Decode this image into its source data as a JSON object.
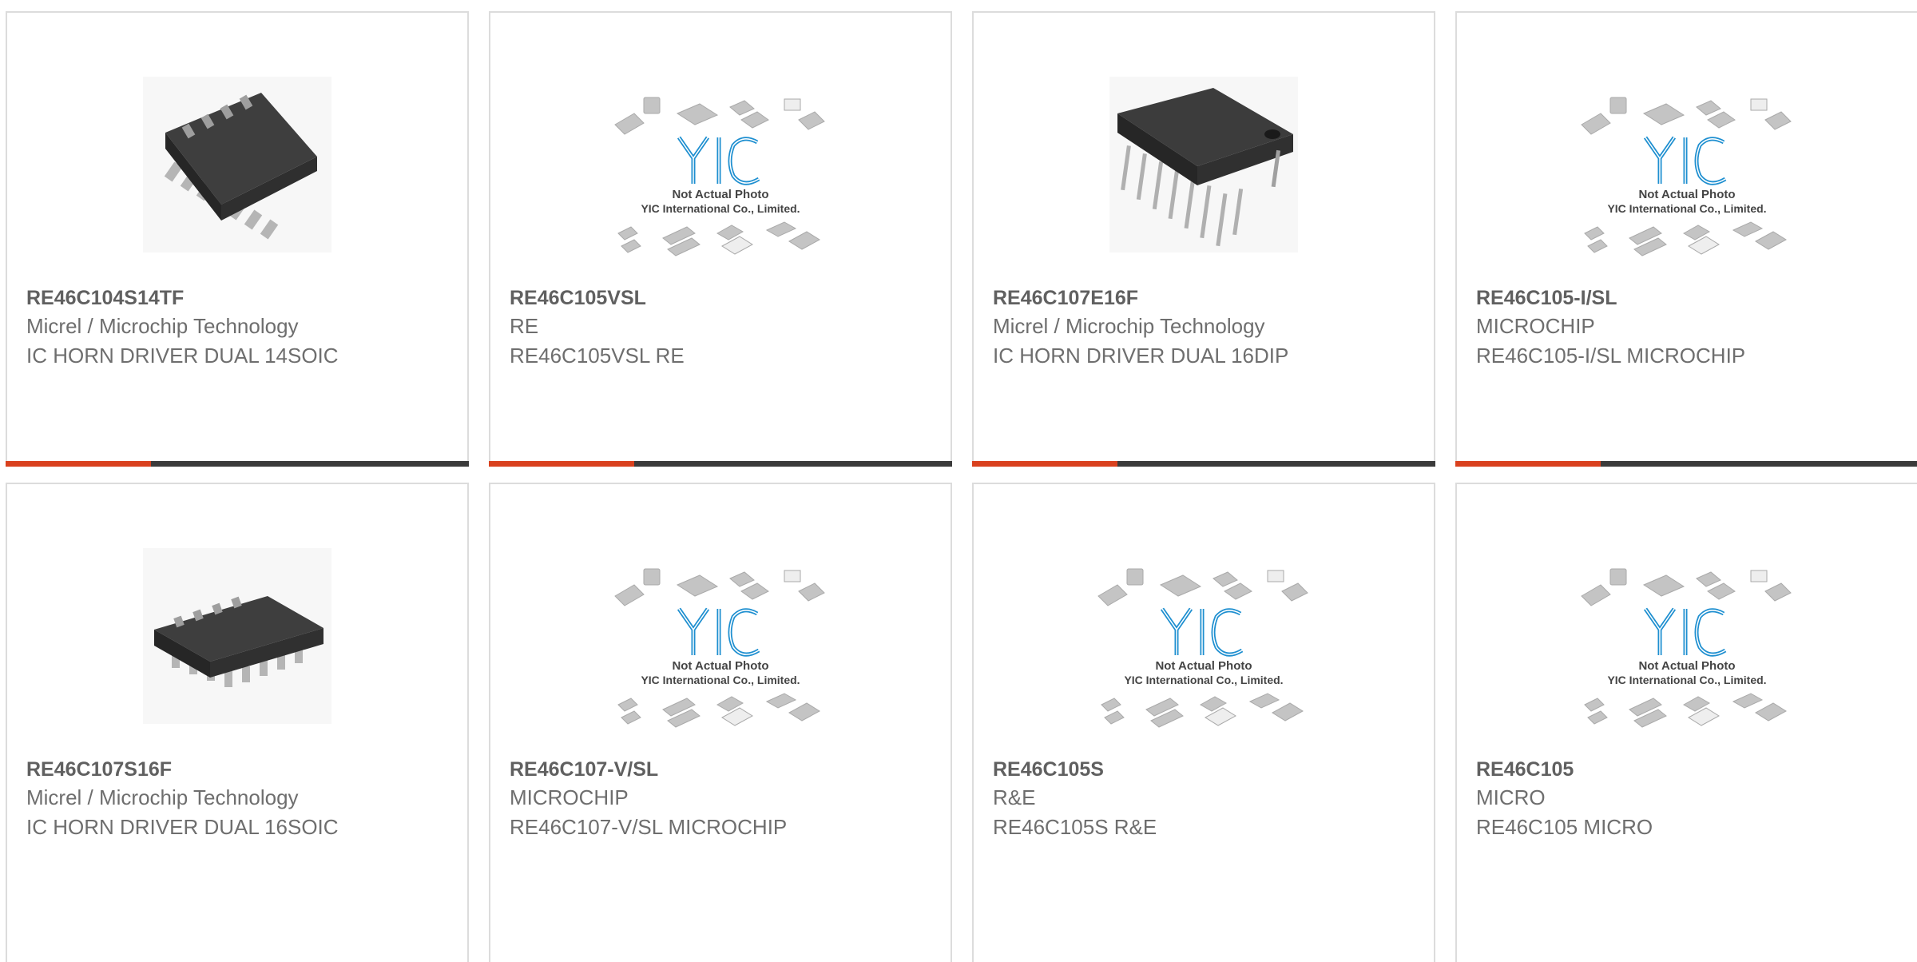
{
  "products": [
    {
      "part_number": "RE46C104S14TF",
      "manufacturer": "Micrel / Microchip Technology",
      "description": "IC HORN DRIVER DUAL 14SOIC",
      "image": "soic-14-chip-photo"
    },
    {
      "part_number": "RE46C105VSL",
      "manufacturer": "RE",
      "description": "RE46C105VSL RE",
      "image": "yic-placeholder"
    },
    {
      "part_number": "RE46C107E16F",
      "manufacturer": "Micrel / Microchip Technology",
      "description": "IC HORN DRIVER DUAL 16DIP",
      "image": "dip-16-chip-photo"
    },
    {
      "part_number": "RE46C105-I/SL",
      "manufacturer": "MICROCHIP",
      "description": "RE46C105-I/SL MICROCHIP",
      "image": "yic-placeholder"
    },
    {
      "part_number": "RE46C107S16F",
      "manufacturer": "Micrel / Microchip Technology",
      "description": "IC HORN DRIVER DUAL 16SOIC",
      "image": "soic-16-chip-photo"
    },
    {
      "part_number": "RE46C107-V/SL",
      "manufacturer": "MICROCHIP",
      "description": "RE46C107-V/SL MICROCHIP",
      "image": "yic-placeholder"
    },
    {
      "part_number": "RE46C105S",
      "manufacturer": "R&E",
      "description": "RE46C105S R&E",
      "image": "yic-placeholder"
    },
    {
      "part_number": "RE46C105",
      "manufacturer": "MICRO",
      "description": "RE46C105 MICRO",
      "image": "yic-placeholder"
    }
  ],
  "placeholder": {
    "logo_text": "YIC",
    "line1": "Not Actual Photo",
    "line2": "YIC International Co., Limited."
  },
  "colors": {
    "accent_red": "#d9411e",
    "accent_dark": "#3b3b3b",
    "border": "#dcdcdc",
    "logo_blue": "#1e8fd0"
  }
}
